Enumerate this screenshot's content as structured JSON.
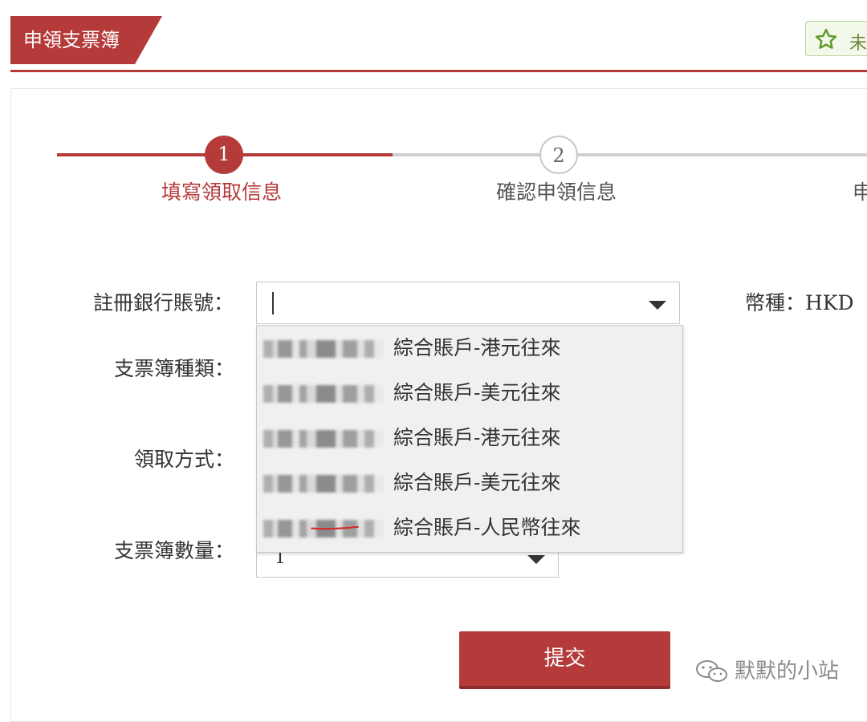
{
  "header": {
    "title": "申領支票簿",
    "favorite_label": "未",
    "favorite_icon": "star-icon"
  },
  "stepper": {
    "steps": [
      {
        "number": "1",
        "label": "填寫領取信息",
        "state": "active"
      },
      {
        "number": "2",
        "label": "確認申領信息",
        "state": "inactive"
      },
      {
        "number": "",
        "label": "申",
        "state": "inactive"
      }
    ]
  },
  "form": {
    "account_label": "註冊銀行賬號：",
    "account_value": "",
    "currency_text": "幣種：HKD",
    "cheque_type_label": "支票簿種類：",
    "pickup_method_label": "領取方式：",
    "quantity_label": "支票簿數量：",
    "quantity_value": "1",
    "account_options": [
      {
        "number_masked": "████████",
        "label": "綜合賬戶-港元往來"
      },
      {
        "number_masked": "████████",
        "label": "綜合賬戶-美元往來"
      },
      {
        "number_masked": "████████",
        "label": "綜合賬戶-港元往來"
      },
      {
        "number_masked": "████████",
        "label": "綜合賬戶-美元往來"
      },
      {
        "number_masked": "████████",
        "label": "綜合賬戶-人民幣往來"
      }
    ],
    "submit_label": "提交"
  },
  "watermark": {
    "text": "默默的小站",
    "icon": "wechat-icon"
  },
  "colors": {
    "brand_red": "#b53a3a",
    "inactive_gray": "#cfcfcf",
    "dropdown_bg": "#f0f0f0"
  }
}
